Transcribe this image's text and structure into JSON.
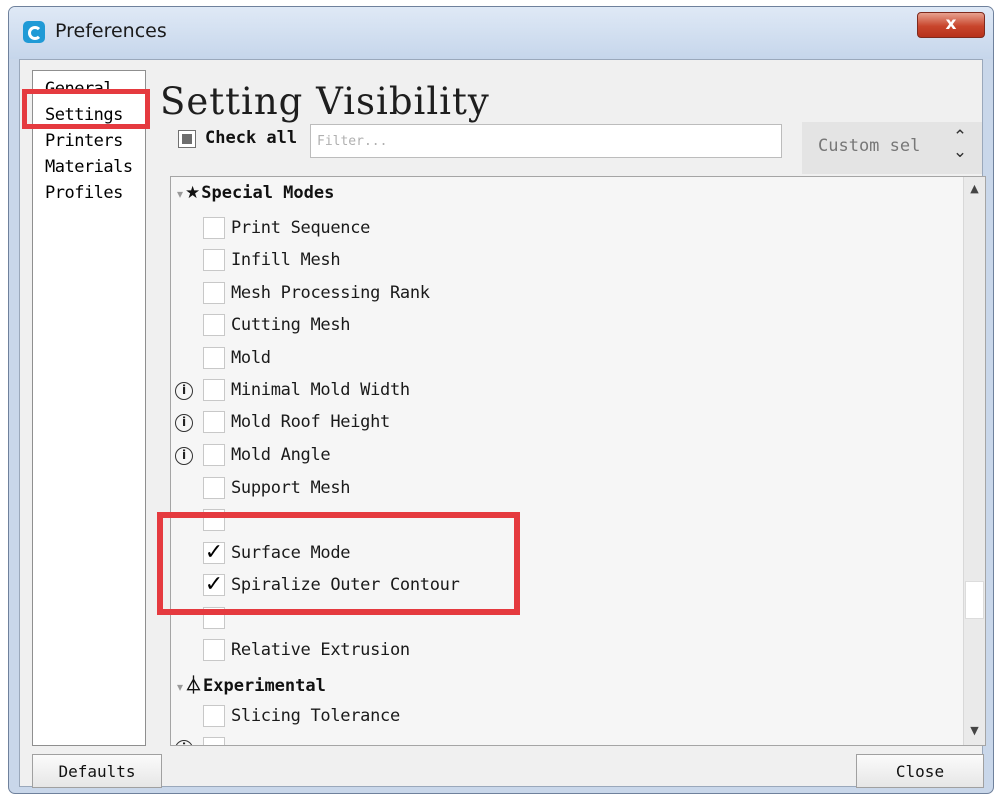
{
  "window": {
    "title": "Preferences",
    "close_glyph": "x"
  },
  "nav": {
    "items": [
      {
        "label": "General"
      },
      {
        "label": "Settings"
      },
      {
        "label": "Printers"
      },
      {
        "label": "Materials"
      },
      {
        "label": "Profiles"
      }
    ],
    "selected": "Settings"
  },
  "page": {
    "title": "Setting Visibility",
    "check_all_label": "Check all",
    "check_all_state": "partial",
    "filter_placeholder": "Filter...",
    "combo_value": "Custom sel"
  },
  "list": {
    "sections": [
      {
        "label": "Special Modes",
        "icon": "star-icon"
      },
      {
        "label": "Experimental",
        "icon": "flask-icon"
      }
    ],
    "items": [
      {
        "label": "Print Sequence",
        "checked": false,
        "info": false
      },
      {
        "label": "Infill Mesh",
        "checked": false,
        "info": false
      },
      {
        "label": "Mesh Processing Rank",
        "checked": false,
        "info": false
      },
      {
        "label": "Cutting Mesh",
        "checked": false,
        "info": false
      },
      {
        "label": "Mold",
        "checked": false,
        "info": false
      },
      {
        "label": "Minimal Mold Width",
        "checked": false,
        "info": true
      },
      {
        "label": "Mold Roof Height",
        "checked": false,
        "info": true
      },
      {
        "label": "Mold Angle",
        "checked": false,
        "info": true
      },
      {
        "label": "Support Mesh",
        "checked": false,
        "info": false
      },
      {
        "label": "Surface Mode",
        "checked": true,
        "info": false
      },
      {
        "label": "Spiralize Outer Contour",
        "checked": true,
        "info": false
      },
      {
        "label": "Relative Extrusion",
        "checked": false,
        "info": false
      },
      {
        "label": "Slicing Tolerance",
        "checked": false,
        "info": false
      }
    ],
    "check_glyph": "✓",
    "info_glyph": "i"
  },
  "buttons": {
    "defaults": "Defaults",
    "close": "Close"
  },
  "colors": {
    "highlight_red": "#e53a3f",
    "title_bar": "#c6d6eb",
    "close_button": "#c8452c"
  }
}
